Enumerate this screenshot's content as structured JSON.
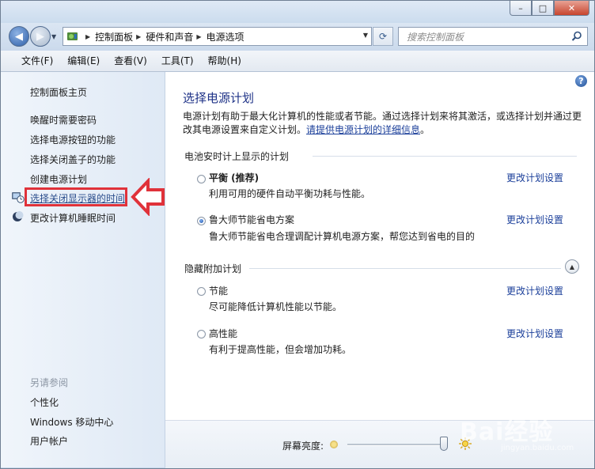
{
  "window": {
    "controls": {
      "minimize": "–",
      "maximize": "□",
      "close": "✕"
    }
  },
  "addressbar": {
    "crumbs": [
      "控制面板",
      "硬件和声音",
      "电源选项"
    ],
    "search_placeholder": "搜索控制面板"
  },
  "menu": [
    "文件(F)",
    "编辑(E)",
    "查看(V)",
    "工具(T)",
    "帮助(H)"
  ],
  "sidebar": {
    "home": "控制面板主页",
    "links": [
      "唤醒时需要密码",
      "选择电源按钮的功能",
      "选择关闭盖子的功能",
      "创建电源计划",
      "选择关闭显示器的时间",
      "更改计算机睡眠时间"
    ],
    "see_also_title": "另请参阅",
    "see_also": [
      "个性化",
      "Windows 移动中心",
      "用户帐户"
    ]
  },
  "main": {
    "title": "选择电源计划",
    "description": "电源计划有助于最大化计算机的性能或者节能。通过选择计划来将其激活，或选择计划并通过更改其电源设置来自定义计划。",
    "description_link": "请提供电源计划的详细信息",
    "description_end": "。",
    "group_battery": "电池安时计上显示的计划",
    "group_hidden": "隐藏附加计划",
    "change_link": "更改计划设置",
    "plans": [
      {
        "name": "平衡 (推荐)",
        "desc": "利用可用的硬件自动平衡功耗与性能。",
        "selected": false
      },
      {
        "name": "鲁大师节能省电方案",
        "desc": "鲁大师节能省电合理调配计算机电源方案，帮您达到省电的目的",
        "selected": true
      },
      {
        "name": "节能",
        "desc": "尽可能降低计算机性能以节能。",
        "selected": false
      },
      {
        "name": "高性能",
        "desc": "有利于提高性能，但会增加功耗。",
        "selected": false
      }
    ]
  },
  "brightness": {
    "label": "屏幕亮度:",
    "level": 0.97
  },
  "watermark": {
    "brand": "Bai经验",
    "url": "jingyan.baidu.com"
  },
  "colors": {
    "annotation_red": "#e0323a",
    "link_blue": "#1b3f9a",
    "title_blue": "#1e3287"
  }
}
